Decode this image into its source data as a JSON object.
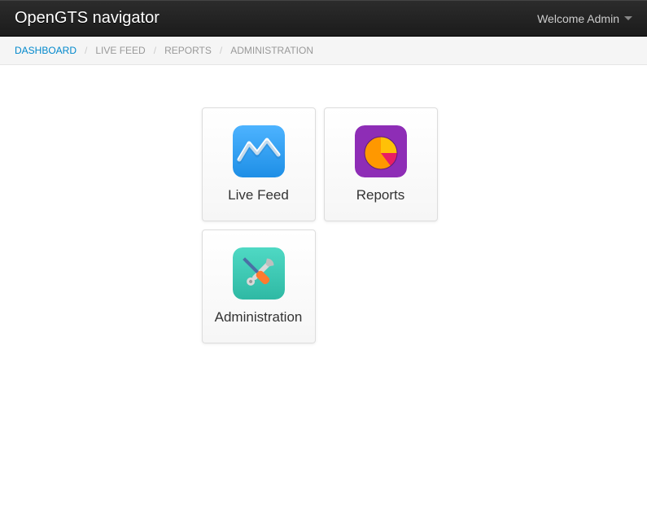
{
  "header": {
    "brand": "OpenGTS navigator",
    "welcome": "Welcome Admin"
  },
  "breadcrumb": {
    "dashboard": "DASHBOARD",
    "livefeed": "LIVE FEED",
    "reports": "REPORTS",
    "administration": "ADMINISTRATION"
  },
  "tiles": {
    "livefeed": "Live Feed",
    "reports": "Reports",
    "administration": "Administration"
  }
}
